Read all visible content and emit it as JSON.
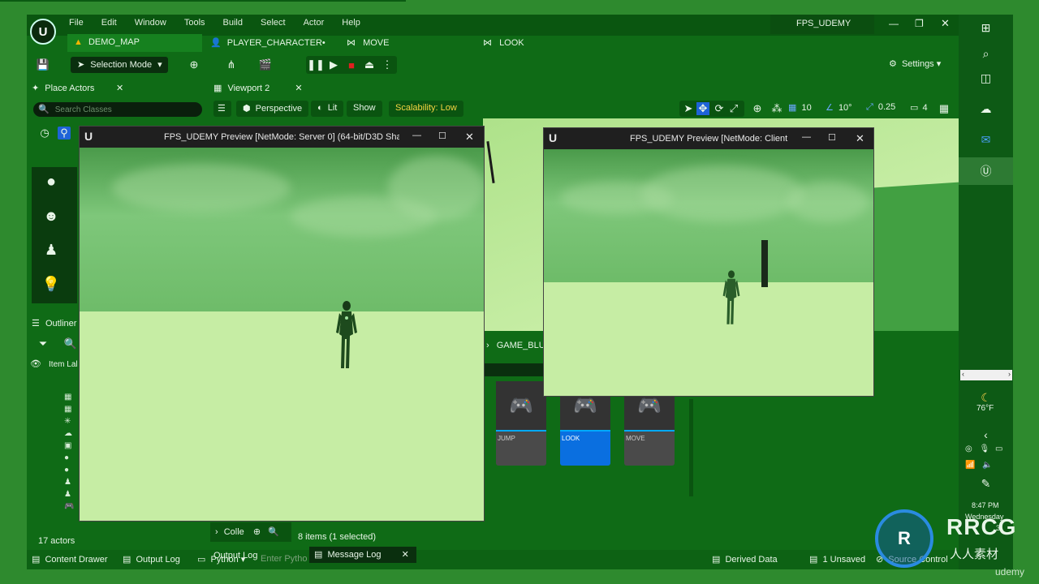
{
  "menu": [
    "File",
    "Edit",
    "Window",
    "Tools",
    "Build",
    "Select",
    "Actor",
    "Help"
  ],
  "project_name": "FPS_UDEMY",
  "tabs": [
    {
      "label": "DEMO_MAP"
    },
    {
      "label": "PLAYER_CHARACTER•"
    },
    {
      "label": "MOVE"
    },
    {
      "label": "LOOK"
    }
  ],
  "toolbar": {
    "selection_mode": "Selection Mode",
    "settings": "Settings"
  },
  "place_actors": {
    "title": "Place Actors",
    "search_placeholder": "Search Classes"
  },
  "viewport": {
    "tab_label": "Viewport 2",
    "perspective": "Perspective",
    "lit": "Lit",
    "show": "Show",
    "scalability": "Scalability: Low",
    "grid_value": "10",
    "angle_value": "10°",
    "scale_value": "0.25",
    "camera_speed": "4"
  },
  "outliner": {
    "title": "Outliner",
    "column_label": "Item Lal",
    "actor_count": "17 actors"
  },
  "server_window": {
    "title": "FPS_UDEMY Preview [NetMode: Server 0]  (64-bit/D3D Sha"
  },
  "client_window": {
    "title": "FPS_UDEMY Preview [NetMode: Client 1"
  },
  "content_browser": {
    "path": "GAME_BLU",
    "collections_label": "Colle",
    "items_status": "8 items (1 selected)",
    "assets": [
      {
        "label": "JUMP",
        "selected": false
      },
      {
        "label": "LOOK",
        "selected": true
      },
      {
        "label": "MOVE",
        "selected": false
      }
    ]
  },
  "statusbar": {
    "content_drawer": "Content Drawer",
    "output_log": "Output Log",
    "cmd": "Cmd",
    "python": "Python",
    "python_placeholder": "Enter Pytho",
    "output_log_tab": "Output Log",
    "message_log_tab": "Message Log",
    "derived_data": "Derived Data",
    "unsaved": "1 Unsaved",
    "source_control": "Source Control"
  },
  "taskbar": {
    "weather_temp": "76°F",
    "time": "8:47 PM",
    "day": "Wednesday",
    "notification_count": "3"
  },
  "watermark": {
    "brand": "RRCG",
    "subtitle": "人人素材",
    "udemy": "udemy"
  },
  "colors": {
    "editor_bg": "#0f6b16",
    "selection_blue": "#0a6fe0",
    "scalability_yellow": "#f5d442"
  }
}
